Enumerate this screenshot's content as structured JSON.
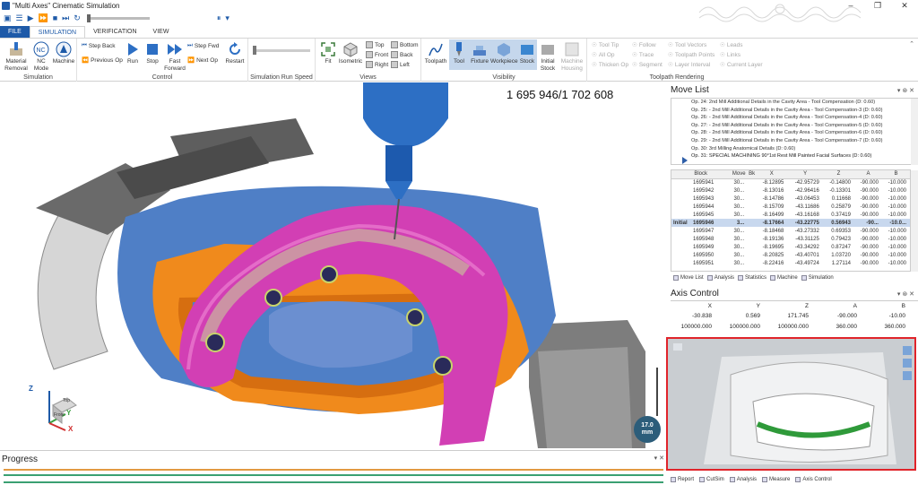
{
  "window": {
    "title": "\"Multi Axes\" Cinematic Simulation"
  },
  "tabs": [
    {
      "label": "FILE"
    },
    {
      "label": "SIMULATION"
    },
    {
      "label": "VERIFICATION"
    },
    {
      "label": "VIEW"
    }
  ],
  "ribbon": {
    "simulation": {
      "label": "Simulation",
      "material_removal": "Material Removal",
      "nc_mode": "NC Mode",
      "machine": "Machine"
    },
    "control": {
      "label": "Control",
      "step_back": "Step Back",
      "previous_op": "Previous Op",
      "run": "Run",
      "stop": "Stop",
      "fast_forward": "Fast Forward",
      "step_fwd": "Step Fwd",
      "next_op": "Next Op",
      "restart": "Restart"
    },
    "speed": {
      "label": "Simulation Run Speed"
    },
    "views": {
      "label": "Views",
      "fit": "Fit",
      "isometric": "Isometric",
      "top": "Top",
      "front": "Front",
      "right": "Right",
      "bottom": "Bottom",
      "back": "Back",
      "left": "Left"
    },
    "visibility": {
      "label": "Visibility",
      "toolpath": "Toolpath",
      "tool": "Tool",
      "fixture": "Fixture",
      "workpiece": "Workpiece",
      "stock": "Stock",
      "initial_stock": "Initial Stock",
      "machine_housing": "Machine Housing"
    },
    "toolpath_rendering": {
      "label": "Toolpath Rendering",
      "tool_tip": "Tool Tip",
      "all_op": "All Op",
      "thicken_op": "Thicken Op",
      "follow": "Follow",
      "trace": "Trace",
      "segment": "Segment",
      "tool_vectors": "Tool Vectors",
      "toolpath_points": "Toolpath Points",
      "layer_interval": "Layer Interval",
      "leads": "Leads",
      "links": "Links",
      "current_layer": "Current Layer"
    }
  },
  "viewport": {
    "coord_readout": "1 695 946/1 702 608",
    "scale_badge_value": "17.0",
    "scale_badge_unit": "mm"
  },
  "triad": {
    "z": "Z",
    "y": "Y",
    "x": "X",
    "front": "Front",
    "top": "Top"
  },
  "progress": {
    "title": "Progress"
  },
  "move_list": {
    "title": "Move List",
    "operations": [
      "Op. 24: 2nd Mill Additional Details in the Cavity Area - Tool Compensation (D: 0.60)",
      "Op. 25: - 2nd Mill Additional Details in the Cavity Area - Tool Compensation-3 (D: 0.60)",
      "Op. 26: - 2nd Mill Additional Details in the Cavity Area - Tool Compensation-4 (D: 0.60)",
      "Op. 27: - 2nd Mill Additional Details in the Cavity Area - Tool Compensation-5 (D: 0.60)",
      "Op. 28: - 2nd Mill Additional Details in the Cavity Area - Tool Compensation-6 (D: 0.60)",
      "Op. 29: - 2nd Mill Additional Details in the Cavity Area - Tool Compensation-7 (D: 0.60)",
      "Op. 30: 3rd Milling Anatomical Details (D: 0.60)",
      "Op. 31: SPECIAL MACHINING 90°1st Rest Mill Painted Facial Surfaces (D: 0.60)"
    ],
    "columns": [
      "Block",
      "Move",
      "Bk",
      "X",
      "Y",
      "Z",
      "A",
      "B"
    ],
    "rows": [
      {
        "block": "1695941",
        "move": "30...",
        "x": "-8.12895",
        "y": "-42.95729",
        "z": "-0.14800",
        "a": "-90.000",
        "b": "-10.000"
      },
      {
        "block": "1695942",
        "move": "30...",
        "x": "-8.13016",
        "y": "-42.96416",
        "z": "-0.13301",
        "a": "-90.000",
        "b": "-10.000"
      },
      {
        "block": "1695943",
        "move": "30...",
        "x": "-8.14786",
        "y": "-43.06453",
        "z": "0.11668",
        "a": "-90.000",
        "b": "-10.000"
      },
      {
        "block": "1695944",
        "move": "30...",
        "x": "-8.15709",
        "y": "-43.11686",
        "z": "0.25879",
        "a": "-90.000",
        "b": "-10.000"
      },
      {
        "block": "1695945",
        "move": "30...",
        "x": "-8.16499",
        "y": "-43.16168",
        "z": "0.37419",
        "a": "-90.000",
        "b": "-10.000"
      },
      {
        "block": "1695946",
        "move": "3...",
        "x": "-8.17664",
        "y": "-43.22775",
        "z": "0.56943",
        "a": "-90...",
        "b": "-10.0..."
      },
      {
        "block": "1695947",
        "move": "30...",
        "x": "-8.18468",
        "y": "-43.27332",
        "z": "0.69353",
        "a": "-90.000",
        "b": "-10.000"
      },
      {
        "block": "1695948",
        "move": "30...",
        "x": "-8.19136",
        "y": "-43.31125",
        "z": "0.79423",
        "a": "-90.000",
        "b": "-10.000"
      },
      {
        "block": "1695949",
        "move": "30...",
        "x": "-8.19695",
        "y": "-43.34292",
        "z": "0.87247",
        "a": "-90.000",
        "b": "-10.000"
      },
      {
        "block": "1695950",
        "move": "30...",
        "x": "-8.20825",
        "y": "-43.40701",
        "z": "1.03720",
        "a": "-90.000",
        "b": "-10.000"
      },
      {
        "block": "1695951",
        "move": "30...",
        "x": "-8.22416",
        "y": "-43.49724",
        "z": "1.27114",
        "a": "-90.000",
        "b": "-10.000"
      }
    ],
    "initial_label": "Initial",
    "tabs": [
      "Move List",
      "Analysis",
      "Statistics",
      "Machine",
      "Simulation"
    ]
  },
  "axis_control": {
    "title": "Axis Control",
    "headers": [
      "X",
      "Y",
      "Z",
      "A",
      "B"
    ],
    "values": [
      "-30.838",
      "0.569",
      "171.745",
      "-90.000",
      "-10.00"
    ],
    "limits": [
      "100000.000",
      "100000.000",
      "100000.000",
      "360.000",
      "360.000"
    ]
  },
  "bottom_tabs": [
    "Report",
    "CutSim",
    "Analysis",
    "Measure",
    "Axis Control"
  ],
  "colors": {
    "accent": "#1e5aa8",
    "highlight_row": "#c8d8ee",
    "mini_border": "#e0242a",
    "model_pink": "#d23fb4",
    "fixture_blue": "#4f7fc6",
    "fixture_orange": "#f08a1c"
  }
}
